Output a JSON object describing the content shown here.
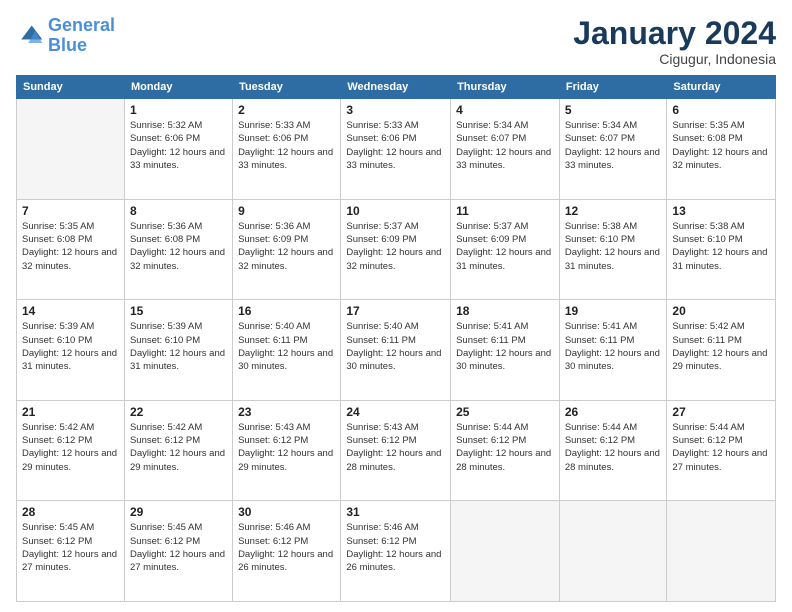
{
  "logo": {
    "line1": "General",
    "line2": "Blue"
  },
  "title": "January 2024",
  "subtitle": "Cigugur, Indonesia",
  "days_header": [
    "Sunday",
    "Monday",
    "Tuesday",
    "Wednesday",
    "Thursday",
    "Friday",
    "Saturday"
  ],
  "weeks": [
    [
      {
        "day": "",
        "sunrise": "",
        "sunset": "",
        "daylight": ""
      },
      {
        "day": "1",
        "sunrise": "Sunrise: 5:32 AM",
        "sunset": "Sunset: 6:06 PM",
        "daylight": "Daylight: 12 hours and 33 minutes."
      },
      {
        "day": "2",
        "sunrise": "Sunrise: 5:33 AM",
        "sunset": "Sunset: 6:06 PM",
        "daylight": "Daylight: 12 hours and 33 minutes."
      },
      {
        "day": "3",
        "sunrise": "Sunrise: 5:33 AM",
        "sunset": "Sunset: 6:06 PM",
        "daylight": "Daylight: 12 hours and 33 minutes."
      },
      {
        "day": "4",
        "sunrise": "Sunrise: 5:34 AM",
        "sunset": "Sunset: 6:07 PM",
        "daylight": "Daylight: 12 hours and 33 minutes."
      },
      {
        "day": "5",
        "sunrise": "Sunrise: 5:34 AM",
        "sunset": "Sunset: 6:07 PM",
        "daylight": "Daylight: 12 hours and 33 minutes."
      },
      {
        "day": "6",
        "sunrise": "Sunrise: 5:35 AM",
        "sunset": "Sunset: 6:08 PM",
        "daylight": "Daylight: 12 hours and 32 minutes."
      }
    ],
    [
      {
        "day": "7",
        "sunrise": "Sunrise: 5:35 AM",
        "sunset": "Sunset: 6:08 PM",
        "daylight": "Daylight: 12 hours and 32 minutes."
      },
      {
        "day": "8",
        "sunrise": "Sunrise: 5:36 AM",
        "sunset": "Sunset: 6:08 PM",
        "daylight": "Daylight: 12 hours and 32 minutes."
      },
      {
        "day": "9",
        "sunrise": "Sunrise: 5:36 AM",
        "sunset": "Sunset: 6:09 PM",
        "daylight": "Daylight: 12 hours and 32 minutes."
      },
      {
        "day": "10",
        "sunrise": "Sunrise: 5:37 AM",
        "sunset": "Sunset: 6:09 PM",
        "daylight": "Daylight: 12 hours and 32 minutes."
      },
      {
        "day": "11",
        "sunrise": "Sunrise: 5:37 AM",
        "sunset": "Sunset: 6:09 PM",
        "daylight": "Daylight: 12 hours and 31 minutes."
      },
      {
        "day": "12",
        "sunrise": "Sunrise: 5:38 AM",
        "sunset": "Sunset: 6:10 PM",
        "daylight": "Daylight: 12 hours and 31 minutes."
      },
      {
        "day": "13",
        "sunrise": "Sunrise: 5:38 AM",
        "sunset": "Sunset: 6:10 PM",
        "daylight": "Daylight: 12 hours and 31 minutes."
      }
    ],
    [
      {
        "day": "14",
        "sunrise": "Sunrise: 5:39 AM",
        "sunset": "Sunset: 6:10 PM",
        "daylight": "Daylight: 12 hours and 31 minutes."
      },
      {
        "day": "15",
        "sunrise": "Sunrise: 5:39 AM",
        "sunset": "Sunset: 6:10 PM",
        "daylight": "Daylight: 12 hours and 31 minutes."
      },
      {
        "day": "16",
        "sunrise": "Sunrise: 5:40 AM",
        "sunset": "Sunset: 6:11 PM",
        "daylight": "Daylight: 12 hours and 30 minutes."
      },
      {
        "day": "17",
        "sunrise": "Sunrise: 5:40 AM",
        "sunset": "Sunset: 6:11 PM",
        "daylight": "Daylight: 12 hours and 30 minutes."
      },
      {
        "day": "18",
        "sunrise": "Sunrise: 5:41 AM",
        "sunset": "Sunset: 6:11 PM",
        "daylight": "Daylight: 12 hours and 30 minutes."
      },
      {
        "day": "19",
        "sunrise": "Sunrise: 5:41 AM",
        "sunset": "Sunset: 6:11 PM",
        "daylight": "Daylight: 12 hours and 30 minutes."
      },
      {
        "day": "20",
        "sunrise": "Sunrise: 5:42 AM",
        "sunset": "Sunset: 6:11 PM",
        "daylight": "Daylight: 12 hours and 29 minutes."
      }
    ],
    [
      {
        "day": "21",
        "sunrise": "Sunrise: 5:42 AM",
        "sunset": "Sunset: 6:12 PM",
        "daylight": "Daylight: 12 hours and 29 minutes."
      },
      {
        "day": "22",
        "sunrise": "Sunrise: 5:42 AM",
        "sunset": "Sunset: 6:12 PM",
        "daylight": "Daylight: 12 hours and 29 minutes."
      },
      {
        "day": "23",
        "sunrise": "Sunrise: 5:43 AM",
        "sunset": "Sunset: 6:12 PM",
        "daylight": "Daylight: 12 hours and 29 minutes."
      },
      {
        "day": "24",
        "sunrise": "Sunrise: 5:43 AM",
        "sunset": "Sunset: 6:12 PM",
        "daylight": "Daylight: 12 hours and 28 minutes."
      },
      {
        "day": "25",
        "sunrise": "Sunrise: 5:44 AM",
        "sunset": "Sunset: 6:12 PM",
        "daylight": "Daylight: 12 hours and 28 minutes."
      },
      {
        "day": "26",
        "sunrise": "Sunrise: 5:44 AM",
        "sunset": "Sunset: 6:12 PM",
        "daylight": "Daylight: 12 hours and 28 minutes."
      },
      {
        "day": "27",
        "sunrise": "Sunrise: 5:44 AM",
        "sunset": "Sunset: 6:12 PM",
        "daylight": "Daylight: 12 hours and 27 minutes."
      }
    ],
    [
      {
        "day": "28",
        "sunrise": "Sunrise: 5:45 AM",
        "sunset": "Sunset: 6:12 PM",
        "daylight": "Daylight: 12 hours and 27 minutes."
      },
      {
        "day": "29",
        "sunrise": "Sunrise: 5:45 AM",
        "sunset": "Sunset: 6:12 PM",
        "daylight": "Daylight: 12 hours and 27 minutes."
      },
      {
        "day": "30",
        "sunrise": "Sunrise: 5:46 AM",
        "sunset": "Sunset: 6:12 PM",
        "daylight": "Daylight: 12 hours and 26 minutes."
      },
      {
        "day": "31",
        "sunrise": "Sunrise: 5:46 AM",
        "sunset": "Sunset: 6:12 PM",
        "daylight": "Daylight: 12 hours and 26 minutes."
      },
      {
        "day": "",
        "sunrise": "",
        "sunset": "",
        "daylight": ""
      },
      {
        "day": "",
        "sunrise": "",
        "sunset": "",
        "daylight": ""
      },
      {
        "day": "",
        "sunrise": "",
        "sunset": "",
        "daylight": ""
      }
    ]
  ]
}
